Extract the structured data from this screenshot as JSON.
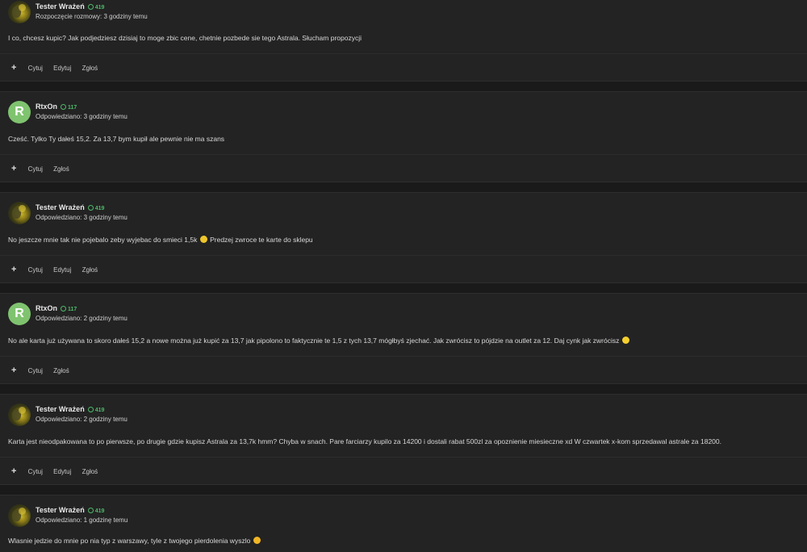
{
  "posts": [
    {
      "author": "Tester Wrażeń",
      "reputation": "419",
      "avatar_type": "image",
      "avatar_letter": "",
      "timestamp": "Rozpoczęcie rozmowy: 3 godziny temu",
      "text": "I co, chcesz kupic? Jak podjedziesz dzisiaj to moge zbic cene, chetnie pozbede sie tego Astrala. Słucham propozycji",
      "emoji": "",
      "actions": [
        "Cytuj",
        "Edytuj",
        "Zgłoś"
      ]
    },
    {
      "author": "RtxOn",
      "reputation": "117",
      "avatar_type": "letter",
      "avatar_letter": "R",
      "timestamp": "Odpowiedziano: 3 godziny temu",
      "text": "Cześć. Tylko Ty dałeś 15,2. Za 13,7 bym kupił ale pewnie nie ma szans",
      "emoji": "",
      "actions": [
        "Cytuj",
        "Zgłoś"
      ]
    },
    {
      "author": "Tester Wrażeń",
      "reputation": "419",
      "avatar_type": "image",
      "avatar_letter": "",
      "timestamp": "Odpowiedziano: 3 godziny temu",
      "text": "No jeszcze mnie tak nie pojebalo zeby wyjebac do smieci 1,5k",
      "emoji": "tear",
      "text_after": "Predzej zwroce te karte do sklepu",
      "actions": [
        "Cytuj",
        "Edytuj",
        "Zgłoś"
      ]
    },
    {
      "author": "RtxOn",
      "reputation": "117",
      "avatar_type": "letter",
      "avatar_letter": "R",
      "timestamp": "Odpowiedziano: 2 godziny temu",
      "text": "No ale karta już używana to skoro dałeś 15,2 a nowe można już kupić za 13,7 jak pipolono to faktycznie te 1,5 z tych 13,7 mógłbyś zjechać. Jak zwrócisz to pójdzie na outlet za 12. Daj cynk jak zwrócisz",
      "emoji": "smile",
      "actions": [
        "Cytuj",
        "Zgłoś"
      ]
    },
    {
      "author": "Tester Wrażeń",
      "reputation": "419",
      "avatar_type": "image",
      "avatar_letter": "",
      "timestamp": "Odpowiedziano: 2 godziny temu",
      "text": "Karta jest nieodpakowana to po pierwsze, po drugie gdzie kupisz Astrala za 13,7k hmm? Chyba w snach. Pare farciarzy kupilo za 14200 i dostali rabat 500zl za opoznienie miesieczne xd W czwartek x-kom sprzedawal astrale za 18200.",
      "emoji": "",
      "actions": [
        "Cytuj",
        "Edytuj",
        "Zgłoś"
      ]
    },
    {
      "author": "Tester Wrażeń",
      "reputation": "419",
      "avatar_type": "image",
      "avatar_letter": "",
      "timestamp": "Odpowiedziano: 1 godzinę temu",
      "text": "Wlasnie jedzie do mnie po nia typ z warszawy, tyle z twojego pierdolenia wyszlo",
      "emoji": "grin",
      "actions": []
    }
  ],
  "plus_icon": "+",
  "colors": {
    "background": "#1a1a1a",
    "post_bg": "#232323",
    "reputation": "#4fb86a",
    "letter_avatar": "#7fc36f"
  }
}
